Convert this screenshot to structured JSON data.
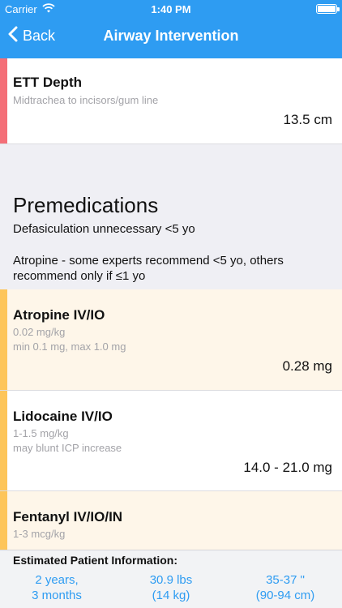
{
  "status_bar": {
    "carrier": "Carrier",
    "time": "1:40 PM",
    "wifi_icon": "wifi-icon",
    "battery_icon": "battery-icon"
  },
  "nav": {
    "back_label": "Back",
    "title": "Airway Intervention"
  },
  "colors": {
    "nav_bg": "#2e9cf2",
    "red_bar": "#f46f78",
    "amber_bar": "#fdc55a",
    "amber_row_bg": "#fef6e9",
    "link": "#2e9cf2"
  },
  "ett": {
    "title": "ETT Depth",
    "subtitle": "Midtrachea to incisors/gum line",
    "value": "13.5 cm"
  },
  "premedications": {
    "heading": "Premedications",
    "note1": "Defasiculation unnecessary <5 yo",
    "note2_line1": "Atropine - some experts recommend <5 yo, others",
    "note2_line2": "recommend only if ≤1 yo",
    "drugs": [
      {
        "title": "Atropine IV/IO",
        "dose": "0.02 mg/kg",
        "note": "min 0.1 mg, max 1.0 mg",
        "value": "0.28 mg"
      },
      {
        "title": "Lidocaine IV/IO",
        "dose": "1-1.5 mg/kg",
        "note": "may blunt ICP increase",
        "value": "14.0 - 21.0 mg"
      },
      {
        "title": "Fentanyl IV/IO/IN",
        "dose": "1-3 mcg/kg"
      }
    ]
  },
  "footer": {
    "label": "Estimated Patient Information:",
    "age_line1": "2 years,",
    "age_line2": "3 months",
    "weight_line1": "30.9 lbs",
    "weight_line2": "(14 kg)",
    "height_line1": "35-37 \"",
    "height_line2": "(90-94 cm)"
  }
}
